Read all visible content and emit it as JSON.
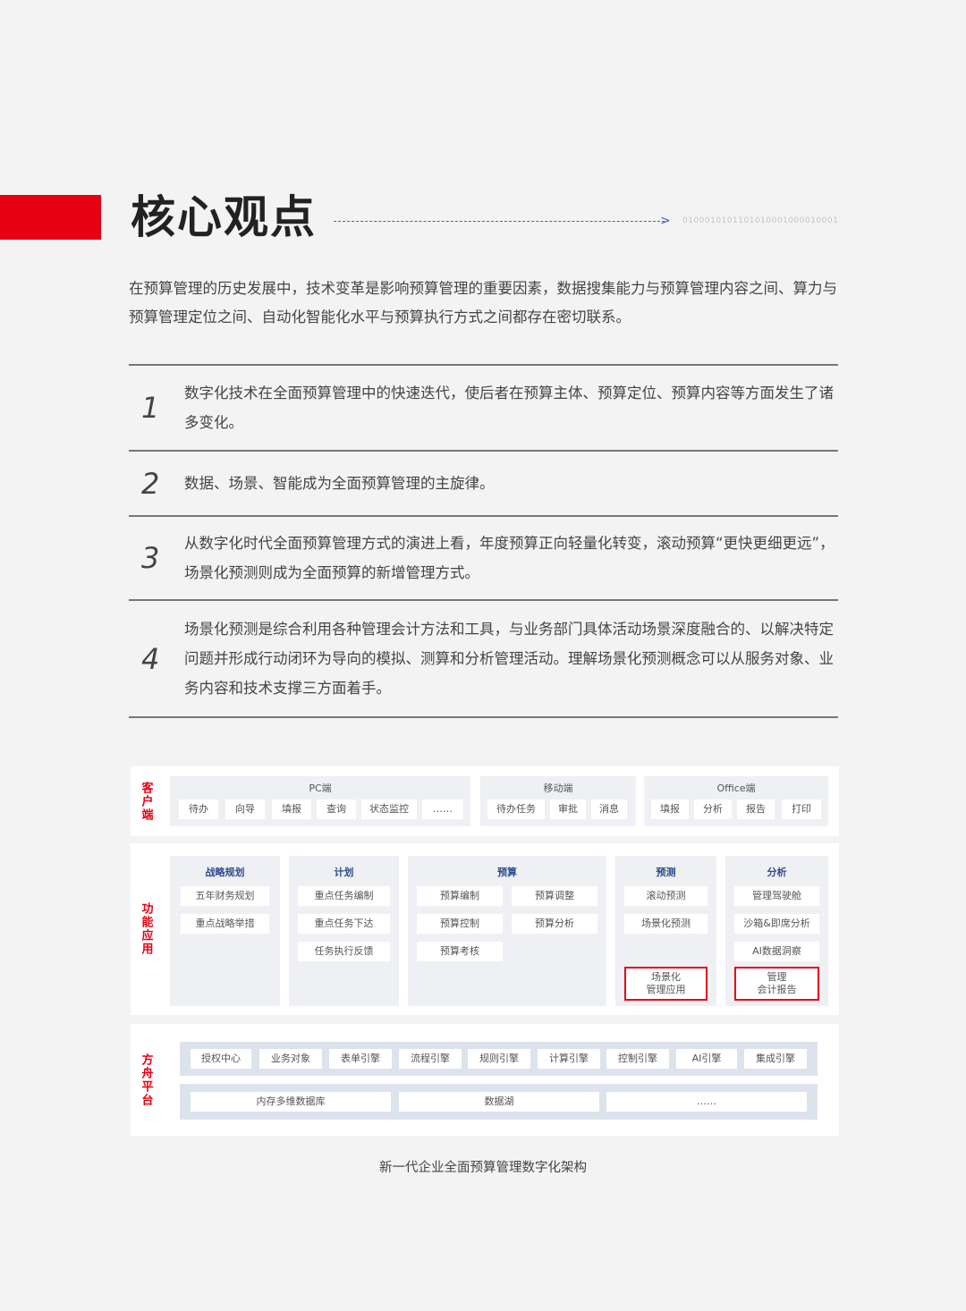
{
  "header": {
    "title": "核心观点",
    "binary": "0100010101101010001000010001"
  },
  "intro": "在预算管理的历史发展中，技术变革是影响预算管理的重要因素，数据搜集能力与预算管理内容之间、算力与预算管理定位之间、自动化智能化水平与预算执行方式之间都存在密切联系。",
  "points": [
    {
      "num": "1",
      "text": "数字化技术在全面预算管理中的快速迭代，使后者在预算主体、预算定位、预算内容等方面发生了诸多变化。"
    },
    {
      "num": "2",
      "text": "数据、场景、智能成为全面预算管理的主旋律。"
    },
    {
      "num": "3",
      "text": "从数字化时代全面预算管理方式的演进上看，年度预算正向轻量化转变，滚动预算“更快更细更远”，场景化预测则成为全面预算的新增管理方式。"
    },
    {
      "num": "4",
      "text": "场景化预测是综合利用各种管理会计方法和工具，与业务部门具体活动场景深度融合的、以解决特定问题并形成行动闭环为导向的模拟、测算和分析管理活动。理解场景化预测概念可以从服务对象、业务内容和技术支撑三方面着手。"
    }
  ],
  "diagram": {
    "client": {
      "label": "客户端",
      "pc": {
        "title": "PC端",
        "items": [
          "待办",
          "向导",
          "填报",
          "查询",
          "状态监控",
          "……"
        ]
      },
      "mobile": {
        "title": "移动端",
        "items": [
          "待办任务",
          "审批",
          "消息"
        ]
      },
      "office": {
        "title": "Office端",
        "items": [
          "填报",
          "分析",
          "报告",
          "打印"
        ]
      }
    },
    "func": {
      "label": "功能应用",
      "strategy": {
        "title": "战略规划",
        "items": [
          "五年财务规划",
          "重点战略举措"
        ]
      },
      "plan": {
        "title": "计划",
        "items": [
          "重点任务编制",
          "重点任务下达",
          "任务执行反馈"
        ]
      },
      "budget": {
        "title": "预算",
        "items": [
          "预算编制",
          "预算调整",
          "预算控制",
          "预算分析",
          "预算考核"
        ]
      },
      "forecast": {
        "title": "预测",
        "items": [
          "滚动预测",
          "场景化预测"
        ],
        "highlight": [
          "场景化",
          "管理应用"
        ]
      },
      "analysis": {
        "title": "分析",
        "items": [
          "管理驾驶舱",
          "沙箱&即席分析",
          "AI数据洞察"
        ],
        "highlight": [
          "管理",
          "会计报告"
        ]
      }
    },
    "platform": {
      "label": "方舟平台",
      "engines": [
        "授权中心",
        "业务对象",
        "表单引擎",
        "流程引擎",
        "规则引擎",
        "计算引擎",
        "控制引擎",
        "AI引擎",
        "集成引擎"
      ],
      "data": [
        "内存多维数据库",
        "数据湖",
        "……"
      ]
    },
    "caption": "新一代企业全面预算管理数字化架构"
  }
}
